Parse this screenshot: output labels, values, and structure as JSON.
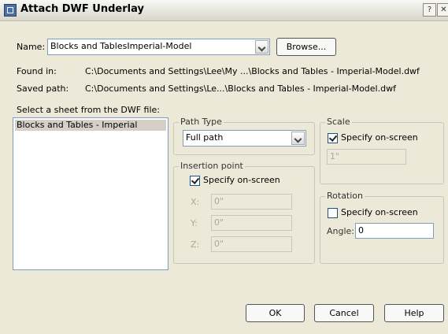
{
  "window": {
    "title": "Attach DWF Underlay",
    "help_button": "?",
    "close_button": "✕"
  },
  "name": {
    "label": "Name:",
    "value": "Blocks and TablesImperial-Model",
    "browse_label": "Browse..."
  },
  "found_in": {
    "label": "Found in:",
    "value": "C:\\Documents and Settings\\Lee\\My ...\\Blocks and Tables - Imperial-Model.dwf"
  },
  "saved_path": {
    "label": "Saved path:",
    "value": "C:\\Documents and Settings\\Le...\\Blocks and Tables - Imperial-Model.dwf"
  },
  "sheet_list": {
    "label": "Select a sheet from the DWF file:",
    "items": [
      "Blocks and Tables - Imperial"
    ]
  },
  "path_type": {
    "title": "Path Type",
    "value": "Full path"
  },
  "insertion_point": {
    "title": "Insertion point",
    "specify_label": "Specify on-screen",
    "specify_checked": true,
    "x_label": "X:",
    "x_value": "0\"",
    "y_label": "Y:",
    "y_value": "0\"",
    "z_label": "Z:",
    "z_value": "0\""
  },
  "scale": {
    "title": "Scale",
    "specify_label": "Specify on-screen",
    "specify_checked": true,
    "value": "1\""
  },
  "rotation": {
    "title": "Rotation",
    "specify_label": "Specify on-screen",
    "specify_checked": false,
    "angle_label": "Angle:",
    "angle_value": "0"
  },
  "buttons": {
    "ok": "OK",
    "cancel": "Cancel",
    "help": "Help"
  }
}
